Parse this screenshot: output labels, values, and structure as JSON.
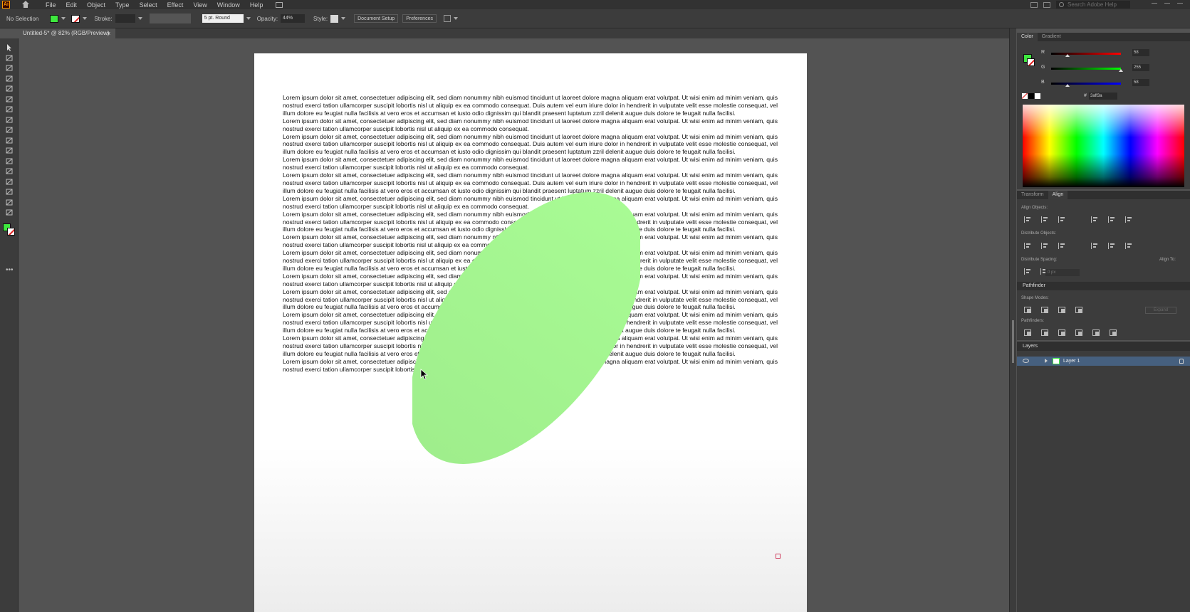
{
  "app": {
    "logo": "Ai"
  },
  "menu": [
    "File",
    "Edit",
    "Object",
    "Type",
    "Select",
    "Effect",
    "View",
    "Window",
    "Help"
  ],
  "search": {
    "placeholder": "Search Adobe Help"
  },
  "control": {
    "selection": "No Selection",
    "stroke_label": "Stroke:",
    "brush": "5 pt. Round",
    "opacity_label": "Opacity:",
    "opacity_value": "44%",
    "style_label": "Style:",
    "doc_setup": "Document Setup",
    "preferences": "Preferences"
  },
  "doc_tab": {
    "title": "Untitled-5* @ 82% (RGB/Preview)",
    "close": "×"
  },
  "colors": {
    "fill": "#3ee83e",
    "shape": "#a6f590",
    "accent": "#46607f"
  },
  "artboard": {
    "paragraphs": [
      "Lorem ipsum dolor sit amet, consectetuer adipiscing elit, sed diam nonummy nibh euismod tincidunt ut laoreet dolore magna aliquam erat volutpat. Ut wisi enim ad minim veniam, quis nostrud exerci tation ullamcorper suscipit lobortis nisl ut aliquip ex ea commodo consequat. Duis autem vel eum iriure dolor in hendrerit in vulputate velit esse molestie consequat, vel illum dolore eu feugiat nulla facilisis at vero eros et accumsan et iusto odio dignissim qui blandit praesent luptatum zzril delenit augue duis dolore te feugait nulla facilisi.",
      "Lorem ipsum dolor sit amet, consectetuer adipiscing elit, sed diam nonummy nibh euismod tincidunt ut laoreet dolore magna aliquam erat volutpat. Ut wisi enim ad minim veniam, quis nostrud exerci tation ullamcorper suscipit lobortis nisl ut aliquip ex ea commodo consequat.",
      "Lorem ipsum dolor sit amet, consectetuer adipiscing elit, sed diam nonummy nibh euismod tincidunt ut laoreet dolore magna aliquam erat volutpat. Ut wisi enim ad minim veniam, quis nostrud exerci tation ullamcorper suscipit lobortis nisl ut aliquip ex ea commodo consequat. Duis autem vel eum iriure dolor in hendrerit in vulputate velit esse molestie consequat, vel illum dolore eu feugiat nulla facilisis at vero eros et accumsan et iusto odio dignissim qui blandit praesent luptatum zzril delenit augue duis dolore te feugait nulla facilisi.",
      "Lorem ipsum dolor sit amet, consectetuer adipiscing elit, sed diam nonummy nibh euismod tincidunt ut laoreet dolore magna aliquam erat volutpat. Ut wisi enim ad minim veniam, quis nostrud exerci tation ullamcorper suscipit lobortis nisl ut aliquip ex ea commodo consequat.",
      "Lorem ipsum dolor sit amet, consectetuer adipiscing elit, sed diam nonummy nibh euismod tincidunt ut laoreet dolore magna aliquam erat volutpat. Ut wisi enim ad minim veniam, quis nostrud exerci tation ullamcorper suscipit lobortis nisl ut aliquip ex ea commodo consequat. Duis autem vel eum iriure dolor in hendrerit in vulputate velit esse molestie consequat, vel illum dolore eu feugiat nulla facilisis at vero eros et accumsan et iusto odio dignissim qui blandit praesent luptatum zzril delenit augue duis dolore te feugait nulla facilisi.",
      "Lorem ipsum dolor sit amet, consectetuer adipiscing elit, sed diam nonummy nibh euismod tincidunt ut laoreet dolore magna aliquam erat volutpat. Ut wisi enim ad minim veniam, quis nostrud exerci tation ullamcorper suscipit lobortis nisl ut aliquip ex ea commodo consequat.",
      "Lorem ipsum dolor sit amet, consectetuer adipiscing elit, sed diam nonummy nibh euismod tincidunt ut laoreet dolore magna aliquam erat volutpat. Ut wisi enim ad minim veniam, quis nostrud exerci tation ullamcorper suscipit lobortis nisl ut aliquip ex ea commodo consequat. Duis autem vel eum iriure dolor in hendrerit in vulputate velit esse molestie consequat, vel illum dolore eu feugiat nulla facilisis at vero eros et accumsan et iusto odio dignissim qui blandit praesent luptatum zzril delenit augue duis dolore te feugait nulla facilisi.",
      "Lorem ipsum dolor sit amet, consectetuer adipiscing elit, sed diam nonummy nibh euismod tincidunt ut laoreet dolore magna aliquam erat volutpat. Ut wisi enim ad minim veniam, quis nostrud exerci tation ullamcorper suscipit lobortis nisl ut aliquip ex ea commodo consequat.",
      "Lorem ipsum dolor sit amet, consectetuer adipiscing elit, sed diam nonummy nibh euismod tincidunt ut laoreet dolore magna aliquam erat volutpat. Ut wisi enim ad minim veniam, quis nostrud exerci tation ullamcorper suscipit lobortis nisl ut aliquip ex ea commodo consequat. Duis autem vel eum iriure dolor in hendrerit in vulputate velit esse molestie consequat, vel illum dolore eu feugiat nulla facilisis at vero eros et accumsan et iusto odio dignissim qui blandit praesent luptatum zzril delenit augue duis dolore te feugait nulla facilisi.",
      "Lorem ipsum dolor sit amet, consectetuer adipiscing elit, sed diam nonummy nibh euismod tincidunt ut laoreet dolore magna aliquam erat volutpat. Ut wisi enim ad minim veniam, quis nostrud exerci tation ullamcorper suscipit lobortis nisl ut aliquip ex ea commodo consequat.",
      "Lorem ipsum dolor sit amet, consectetuer adipiscing elit, sed diam nonummy nibh euismod tincidunt ut laoreet dolore magna aliquam erat volutpat. Ut wisi enim ad minim veniam, quis nostrud exerci tation ullamcorper suscipit lobortis nisl ut aliquip ex ea commodo consequat. Duis autem vel eum iriure dolor in hendrerit in vulputate velit esse molestie consequat, vel illum dolore eu feugiat nulla facilisis at vero eros et accumsan et iusto odio dignissim qui blandit praesent luptatum zzril delenit augue duis dolore te feugait nulla facilisi.",
      "Lorem ipsum dolor sit amet, consectetuer adipiscing elit, sed diam nonummy nibh euismod tincidunt ut laoreet dolore magna aliquam erat volutpat. Ut wisi enim ad minim veniam, quis nostrud exerci tation ullamcorper suscipit lobortis nisl ut aliquip ex ea commodo consequat. Duis autem vel eum iriure dolor in hendrerit in vulputate velit esse molestie consequat, vel illum dolore eu feugiat nulla facilisis at vero eros et accumsan et iusto odio dignissim qui blandit praesent luptatum zzril delenit augue duis dolore te feugait nulla facilisi.",
      "Lorem ipsum dolor sit amet, consectetuer adipiscing elit, sed diam nonummy nibh euismod tincidunt ut laoreet dolore magna aliquam erat volutpat. Ut wisi enim ad minim veniam, quis nostrud exerci tation ullamcorper suscipit lobortis nisl ut aliquip ex ea commodo consequat. Duis autem vel eum iriure dolor in hendrerit in vulputate velit esse molestie consequat, vel illum dolore eu feugiat nulla facilisis at vero eros et accumsan et iusto odio dignissim qui blandit praesent luptatum zzril delenit augue duis dolore te feugait nulla facilisi.",
      "Lorem ipsum dolor sit amet, consectetuer adipiscing elit, sed diam nonummy nibh euismod tincidunt ut laoreet dolore magna aliquam erat volutpat. Ut wisi enim ad minim veniam, quis nostrud exerci tation ullamcorper suscipit lobortis nisl ut aliquip ex ea commodo consequat."
    ]
  },
  "color_panel": {
    "tabs": [
      "Color",
      "Gradient"
    ],
    "sliders": [
      {
        "label": "R",
        "value": "58",
        "level": 0.23,
        "gradient": "linear-gradient(to right,#000,#ff0000)"
      },
      {
        "label": "G",
        "value": "255",
        "level": 1.0,
        "gradient": "linear-gradient(to right,#000,#00ff00)"
      },
      {
        "label": "B",
        "value": "58",
        "level": 0.23,
        "gradient": "linear-gradient(to right,#000,#0000ff)"
      }
    ],
    "hex": "3aff3a"
  },
  "align_panel": {
    "tabs": [
      "Transform",
      "Align"
    ],
    "align_objects": "Align Objects:",
    "distribute_objects": "Distribute Objects:",
    "distribute_spacing": "Distribute Spacing:",
    "align_to": "Align To:",
    "pathfinder": "Pathfinder",
    "shape_modes": "Shape Modes:",
    "pathfinders": "Pathfinders:",
    "expand": "Expand",
    "spacing_value": "0 px"
  },
  "layers_panel": {
    "title": "Layers",
    "layer_name": "Layer 1"
  }
}
